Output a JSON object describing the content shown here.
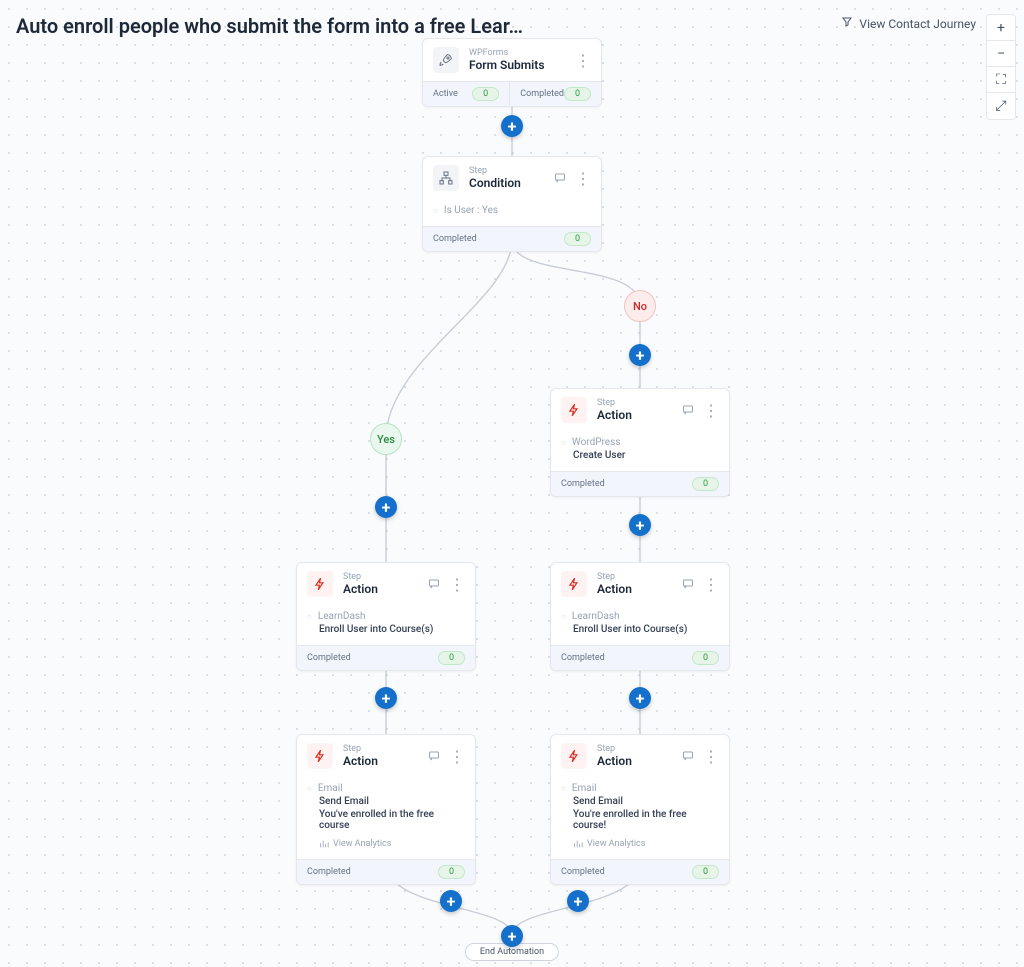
{
  "page_title": "Auto enroll people who submit the form into a free Lear…",
  "header_link": "View Contact Journey",
  "zoom": {
    "in": "+",
    "out": "−",
    "fit": "⛶",
    "expand": "⤢"
  },
  "branch_labels": {
    "yes": "Yes",
    "no": "No"
  },
  "end_label": "End Automation",
  "labels": {
    "active": "Active",
    "completed": "Completed",
    "view_analytics": "View Analytics"
  },
  "nodes": {
    "trigger": {
      "subtitle": "WPForms",
      "title": "Form Submits",
      "active_count": "0",
      "completed_count": "0"
    },
    "condition": {
      "subtitle": "Step",
      "title": "Condition",
      "detail": "Is User : Yes",
      "completed_count": "0"
    },
    "create_user": {
      "subtitle": "Step",
      "title": "Action",
      "line1": "WordPress",
      "line2": "Create User",
      "completed_count": "0"
    },
    "enroll_left": {
      "subtitle": "Step",
      "title": "Action",
      "line1": "LearnDash",
      "line2": "Enroll User into Course(s)",
      "completed_count": "0"
    },
    "enroll_right": {
      "subtitle": "Step",
      "title": "Action",
      "line1": "LearnDash",
      "line2": "Enroll User into Course(s)",
      "completed_count": "0"
    },
    "email_left": {
      "subtitle": "Step",
      "title": "Action",
      "line1": "Email",
      "line2": "Send Email",
      "line3": "You've enrolled in the free course",
      "completed_count": "0"
    },
    "email_right": {
      "subtitle": "Step",
      "title": "Action",
      "line1": "Email",
      "line2": "Send Email",
      "line3": "You're enrolled in the free course!",
      "completed_count": "0"
    }
  }
}
